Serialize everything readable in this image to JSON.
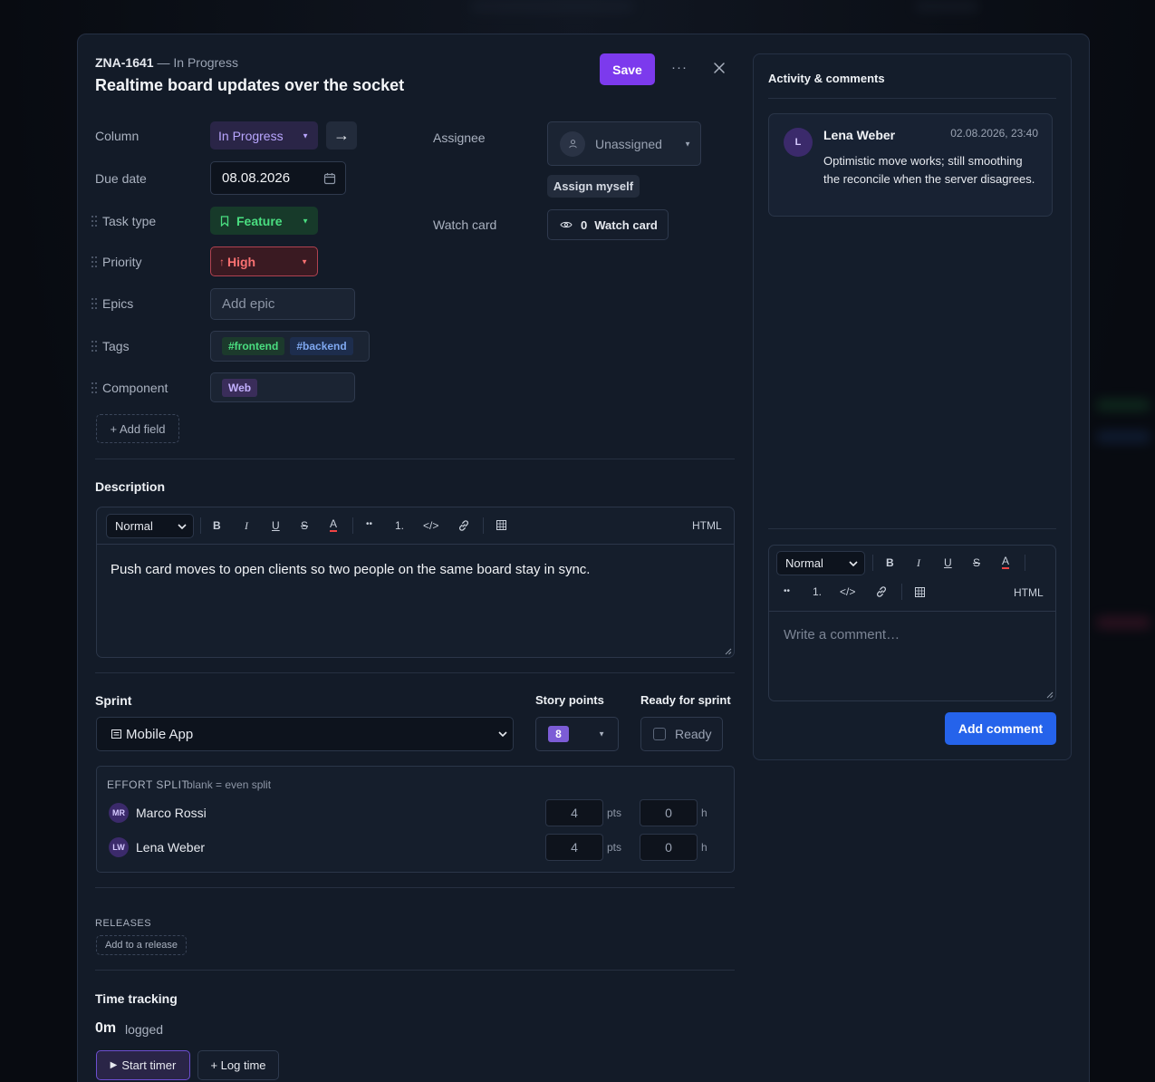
{
  "header": {
    "task_id": "ZNA-1641",
    "status_suffix": "— In Progress",
    "title": "Realtime board updates over the socket",
    "save_label": "Save",
    "more_label": "···"
  },
  "fields": {
    "column_label": "Column",
    "column_value": "In Progress",
    "column_move_arrow": "→",
    "due_label": "Due date",
    "due_value": "08.08.2026",
    "task_type_label": "Task type",
    "task_type_value": "Feature",
    "priority_label": "Priority",
    "priority_value": "High",
    "priority_arrow": "↑",
    "epics_label": "Epics",
    "epics_placeholder": "Add epic",
    "tags_label": "Tags",
    "tags": [
      "#frontend",
      "#backend"
    ],
    "component_label": "Component",
    "component_value": "Web",
    "add_field_label": "+ Add field",
    "assignee_label": "Assignee",
    "assignee_value": "Unassigned",
    "assign_myself_label": "Assign myself",
    "watch_label": "Watch card",
    "watch_count": "0",
    "watch_button_label": "Watch card"
  },
  "description": {
    "title": "Description",
    "format_value": "Normal",
    "toolbar": {
      "bold": "B",
      "italic": "I",
      "underline": "U",
      "strike": "S",
      "color": "A",
      "bullets": "••",
      "ordered": "1.",
      "code": "</>",
      "html": "HTML"
    },
    "text": "Push card moves to open clients so two people on the same board stay in sync."
  },
  "sprint": {
    "title": "Sprint",
    "value": "Mobile App",
    "story_points_label": "Story points",
    "story_points_value": "8",
    "ready_label": "Ready for sprint",
    "ready_checkbox_label": "Ready"
  },
  "effort": {
    "title": "EFFORT SPLIT",
    "hint": "blank = even split",
    "rows": [
      {
        "initials": "MR",
        "name": "Marco Rossi",
        "pts": "4",
        "pts_unit": "pts",
        "hours": "0",
        "hours_unit": "h"
      },
      {
        "initials": "LW",
        "name": "Lena Weber",
        "pts": "4",
        "pts_unit": "pts",
        "hours": "0",
        "hours_unit": "h"
      }
    ]
  },
  "releases": {
    "title": "RELEASES",
    "add_label": "Add to a release"
  },
  "time_tracking": {
    "title": "Time tracking",
    "logged_value": "0m",
    "logged_label": "logged",
    "start_timer_label": "Start timer",
    "log_time_label": "+ Log time"
  },
  "activity": {
    "title": "Activity & comments",
    "comments": [
      {
        "avatar": "L",
        "author": "Lena Weber",
        "timestamp": "02.08.2026, 23:40",
        "text": "Optimistic move works; still smoothing the reconcile when the server disagrees."
      }
    ],
    "editor_format_value": "Normal",
    "editor_html_label": "HTML",
    "comment_placeholder": "Write a comment…",
    "add_comment_label": "Add comment"
  },
  "colors": {
    "accent_purple": "#7c3aed",
    "accent_blue": "#2563eb",
    "feature_green": "#4ade80",
    "priority_red": "#f87171"
  }
}
